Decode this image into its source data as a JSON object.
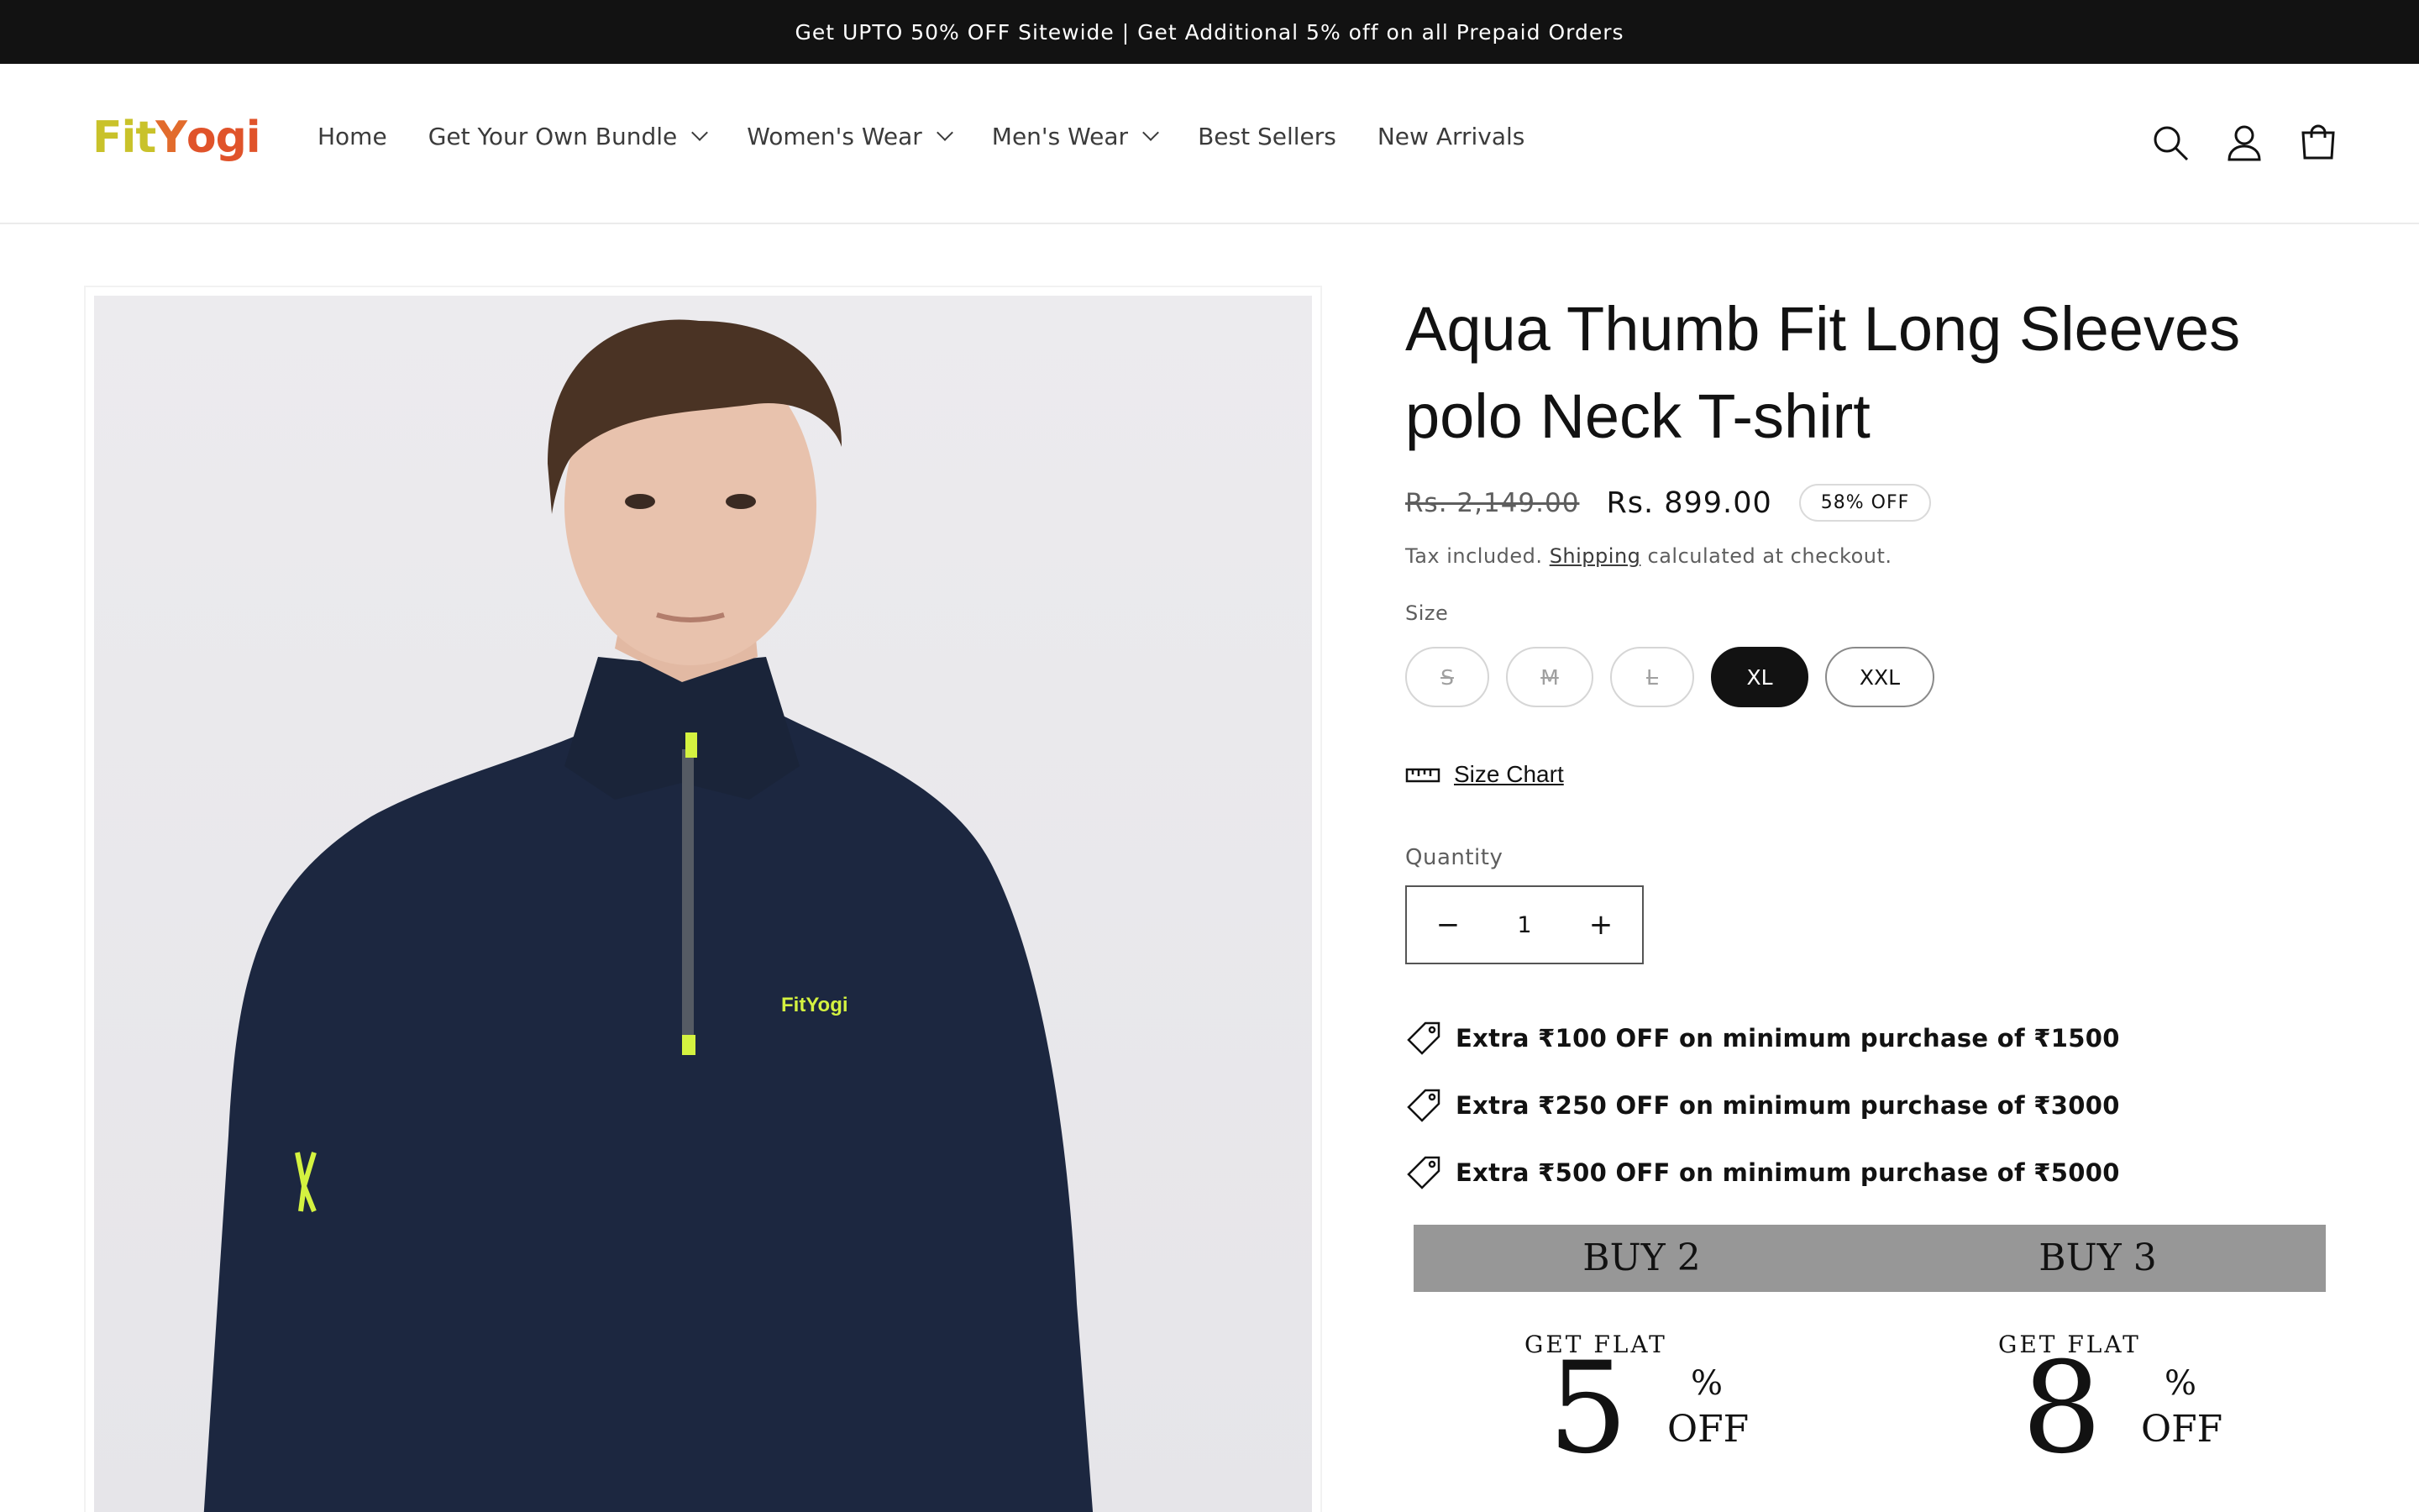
{
  "announcement": {
    "text": "Get UPTO 50% OFF Sitewide | Get Additional 5% off on all Prepaid Orders"
  },
  "header": {
    "logo": {
      "part1": "Fit",
      "part2": "Y",
      "part3": "ogi"
    },
    "nav": [
      {
        "label": "Home",
        "has_dropdown": false
      },
      {
        "label": "Get Your Own Bundle",
        "has_dropdown": true
      },
      {
        "label": "Women's Wear",
        "has_dropdown": true
      },
      {
        "label": "Men's Wear",
        "has_dropdown": true
      },
      {
        "label": "Best Sellers",
        "has_dropdown": false
      },
      {
        "label": "New Arrivals",
        "has_dropdown": false
      }
    ],
    "icons": [
      "search-icon",
      "account-icon",
      "cart-icon"
    ]
  },
  "product": {
    "title": "Aqua Thumb Fit Long Sleeves polo Neck T-shirt",
    "price_old": "Rs. 2,149.00",
    "price_new": "Rs. 899.00",
    "discount_badge": "58% OFF",
    "tax_prefix": "Tax included.",
    "tax_link": "Shipping",
    "tax_suffix": "calculated at checkout.",
    "size_label": "Size",
    "sizes": [
      {
        "label": "S",
        "state": "unavailable"
      },
      {
        "label": "M",
        "state": "unavailable"
      },
      {
        "label": "L",
        "state": "unavailable"
      },
      {
        "label": "XL",
        "state": "selected"
      },
      {
        "label": "XXL",
        "state": "available"
      }
    ],
    "size_chart_label": "Size Chart",
    "quantity_label": "Quantity",
    "quantity_value": "1",
    "offers": [
      "Extra ₹100 OFF on minimum purchase of ₹1500",
      "Extra ₹250 OFF on minimum purchase of ₹3000",
      "Extra ₹500 OFF on minimum purchase of ₹5000"
    ],
    "bundle": {
      "buy2": "BUY 2",
      "buy3": "BUY 3",
      "get_flat": "GET FLAT",
      "deal1_value": "5",
      "deal2_value": "8",
      "percent": "%",
      "off": "OFF"
    },
    "image_logo_text": "FitYogi"
  },
  "colors": {
    "announcement_bg": "#121212",
    "selected_size_bg": "#121212",
    "bundle_bar_bg": "#979797",
    "shirt_navy": "#1c2740",
    "accent_neon": "#d4f240"
  }
}
